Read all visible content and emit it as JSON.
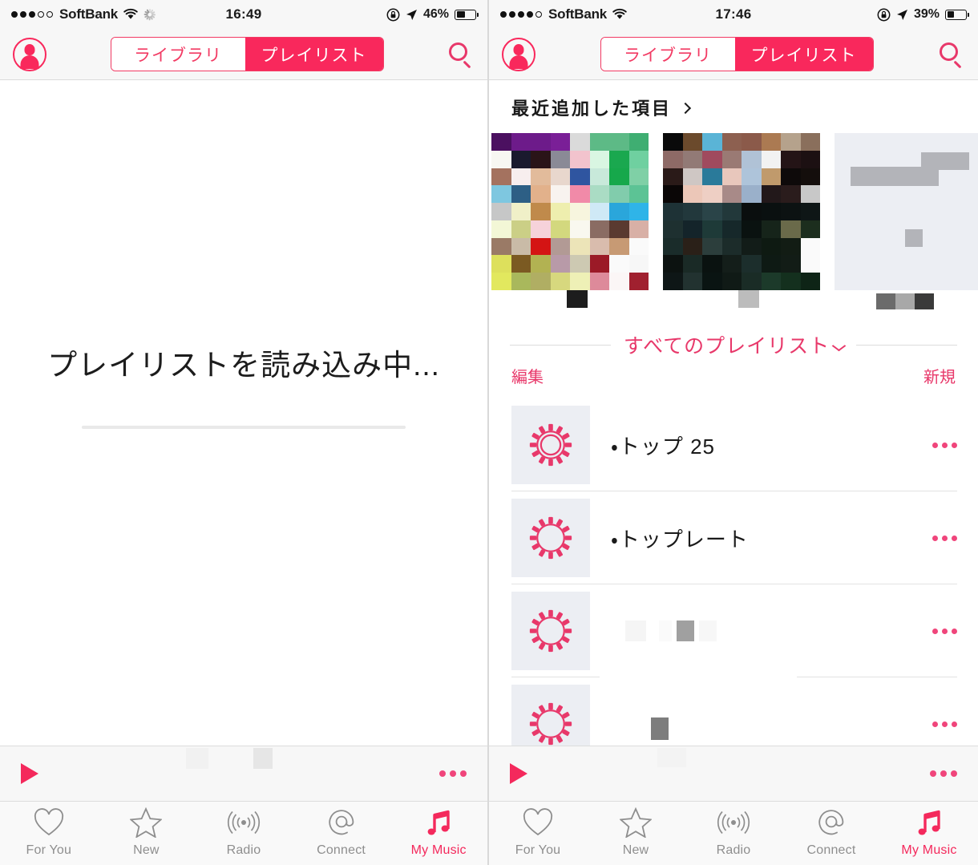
{
  "accent": "#f9285c",
  "accent_alt": "#e8386a",
  "muted": "#8e8e8e",
  "screens": [
    {
      "id": "left",
      "status": {
        "carrier": "SoftBank",
        "signal_filled": 3,
        "signal_total": 5,
        "wifi": "wifi-icon",
        "activity": "spinner-icon",
        "time": "16:49",
        "rotation_lock": "rotation-lock-icon",
        "location": "location-arrow-icon",
        "battery_pct": "46%",
        "battery_level": 46
      },
      "nav": {
        "profile_icon": "person-icon",
        "search_icon": "search-icon",
        "segments": [
          {
            "label": "ライブラリ",
            "selected": false
          },
          {
            "label": "プレイリスト",
            "selected": true
          }
        ]
      },
      "state": "loading",
      "loading": {
        "text": "プレイリストを読み込み中...",
        "progress": 0
      }
    },
    {
      "id": "right",
      "status": {
        "carrier": "SoftBank",
        "signal_filled": 4,
        "signal_total": 5,
        "wifi": "wifi-icon",
        "activity": null,
        "time": "17:46",
        "rotation_lock": "rotation-lock-icon",
        "location": "location-arrow-icon",
        "battery_pct": "39%",
        "battery_level": 39
      },
      "nav": {
        "profile_icon": "person-icon",
        "search_icon": "search-icon",
        "segments": [
          {
            "label": "ライブラリ",
            "selected": false
          },
          {
            "label": "プレイリスト",
            "selected": true
          }
        ]
      },
      "state": "content",
      "recently_added": {
        "title": "最近追加した項目",
        "chevron": "chevron-right-icon",
        "albums": [
          {
            "type": "mosaic",
            "redacted": true
          },
          {
            "type": "mosaic",
            "redacted": true
          },
          {
            "type": "placeholder",
            "redacted": true
          }
        ]
      },
      "all_playlists": {
        "title": "すべてのプレイリスト",
        "chevron": "chevron-down-icon",
        "edit_label": "編集",
        "new_label": "新規"
      },
      "playlists": [
        {
          "title": "・トップ 25",
          "icon": "gear-icon",
          "redacted": false,
          "more": "more-icon"
        },
        {
          "title": "・トップレート",
          "icon": "gear-icon",
          "redacted": false,
          "more": "more-icon"
        },
        {
          "title": "",
          "icon": "gear-icon",
          "redacted": true,
          "more": "more-icon"
        },
        {
          "title": "",
          "icon": "gear-icon",
          "redacted": true,
          "more": "more-icon"
        }
      ]
    }
  ],
  "mini_player": {
    "play_icon": "play-icon",
    "more_icon": "more-icon",
    "track_title": ""
  },
  "tabbar": [
    {
      "label": "For You",
      "icon": "heart-icon",
      "active": false
    },
    {
      "label": "New",
      "icon": "star-icon",
      "active": false
    },
    {
      "label": "Radio",
      "icon": "radio-broadcast-icon",
      "active": false
    },
    {
      "label": "Connect",
      "icon": "at-sign-icon",
      "active": false
    },
    {
      "label": "My Music",
      "icon": "music-note-icon",
      "active": true
    }
  ]
}
